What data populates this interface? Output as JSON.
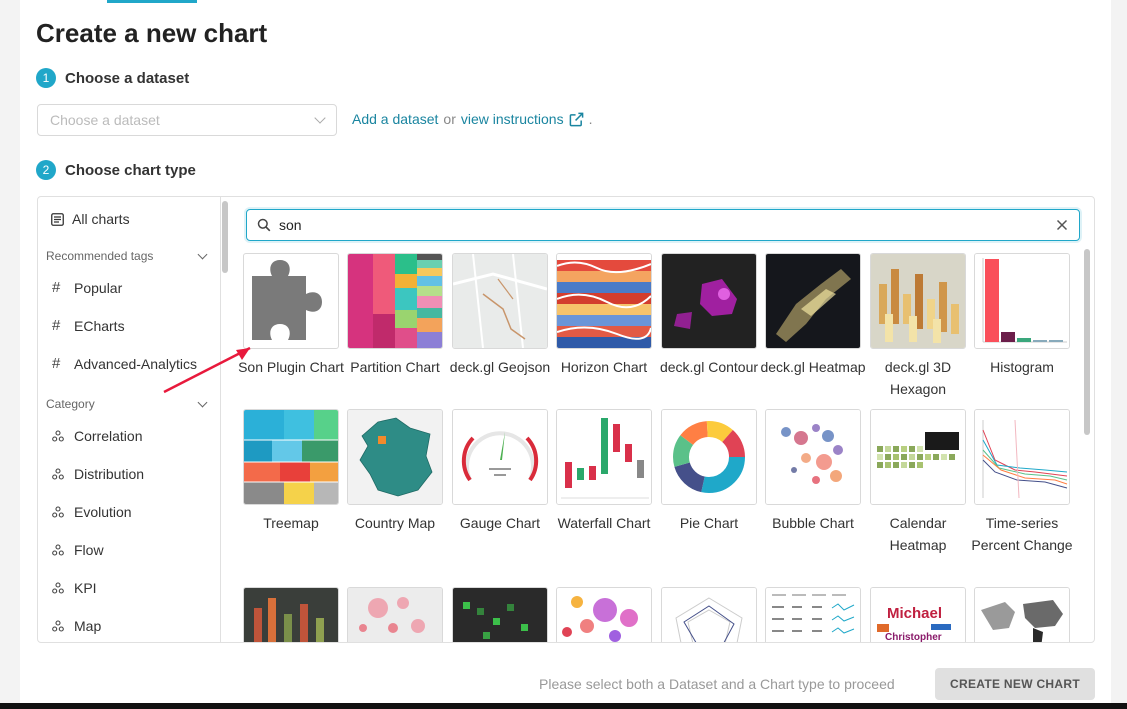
{
  "page_title": "Create a new chart",
  "steps": [
    {
      "num": "1",
      "label": "Choose a dataset"
    },
    {
      "num": "2",
      "label": "Choose chart type"
    }
  ],
  "dataset": {
    "placeholder": "Choose a dataset",
    "add_link": "Add a dataset",
    "or_text": "or",
    "instructions_link": "view instructions",
    "trailing": "."
  },
  "sidebar": {
    "all_charts": "All charts",
    "recommended_header": "Recommended tags",
    "tags": [
      "Popular",
      "ECharts",
      "Advanced-Analytics"
    ],
    "category_header": "Category",
    "categories": [
      "Correlation",
      "Distribution",
      "Evolution",
      "Flow",
      "KPI",
      "Map"
    ]
  },
  "search": {
    "value": "son"
  },
  "charts": [
    {
      "label": "Son Plugin Chart",
      "thumb": "puzzle-icon"
    },
    {
      "label": "Partition Chart",
      "thumb": "partition"
    },
    {
      "label": "deck.gl Geojson",
      "thumb": "geojson"
    },
    {
      "label": "Horizon Chart",
      "thumb": "horizon"
    },
    {
      "label": "deck.gl Contour",
      "thumb": "contour"
    },
    {
      "label": "deck.gl Heatmap",
      "thumb": "heatmap"
    },
    {
      "label": "deck.gl 3D Hexagon",
      "thumb": "hexagon"
    },
    {
      "label": "Histogram",
      "thumb": "histogram"
    },
    {
      "label": "Treemap",
      "thumb": "treemap"
    },
    {
      "label": "Country Map",
      "thumb": "country-map"
    },
    {
      "label": "Gauge Chart",
      "thumb": "gauge"
    },
    {
      "label": "Waterfall Chart",
      "thumb": "waterfall"
    },
    {
      "label": "Pie Chart",
      "thumb": "pie"
    },
    {
      "label": "Bubble Chart",
      "thumb": "bubble"
    },
    {
      "label": "Calendar Heatmap",
      "thumb": "calendar"
    },
    {
      "label": "Time-series Percent Change",
      "thumb": "timeseries"
    },
    {
      "label": "",
      "thumb": "city3d"
    },
    {
      "label": "",
      "thumb": "scatter-map"
    },
    {
      "label": "",
      "thumb": "grid-map"
    },
    {
      "label": "",
      "thumb": "bubbles"
    },
    {
      "label": "",
      "thumb": "radar"
    },
    {
      "label": "",
      "thumb": "table-sparklines"
    },
    {
      "label": "",
      "thumb": "word-cloud"
    },
    {
      "label": "",
      "thumb": "world-map"
    }
  ],
  "thumb_text": {
    "word_cloud_1": "Michael",
    "word_cloud_2": "Christopher"
  },
  "footer": {
    "hint": "Please select both a Dataset and a Chart type to proceed",
    "create_button": "CREATE NEW CHART"
  },
  "colors": {
    "accent": "#20a7c9",
    "link": "#1a85a0",
    "annotation_arrow": "#e8193c"
  }
}
